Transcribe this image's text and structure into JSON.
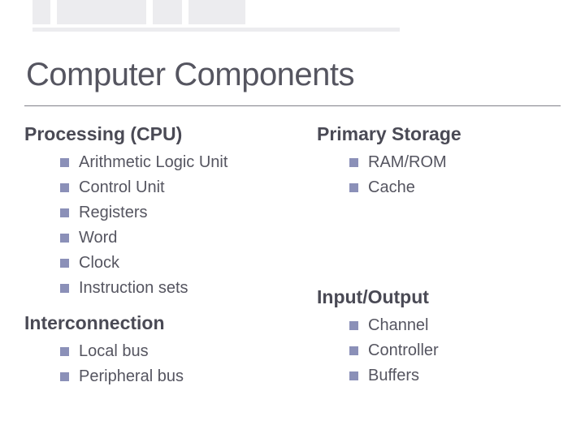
{
  "slide": {
    "title": "Computer Components",
    "sections": {
      "processing": {
        "header": "Processing (CPU)",
        "items": [
          "Arithmetic Logic Unit",
          "Control Unit",
          "Registers",
          "Word",
          "Clock",
          "Instruction sets"
        ]
      },
      "interconnection": {
        "header": "Interconnection",
        "items": [
          "Local bus",
          "Peripheral bus"
        ]
      },
      "primary_storage": {
        "header": "Primary Storage",
        "items": [
          "RAM/ROM",
          "Cache"
        ]
      },
      "io": {
        "header": "Input/Output",
        "items": [
          "Channel",
          "Controller",
          "Buffers"
        ]
      }
    }
  }
}
